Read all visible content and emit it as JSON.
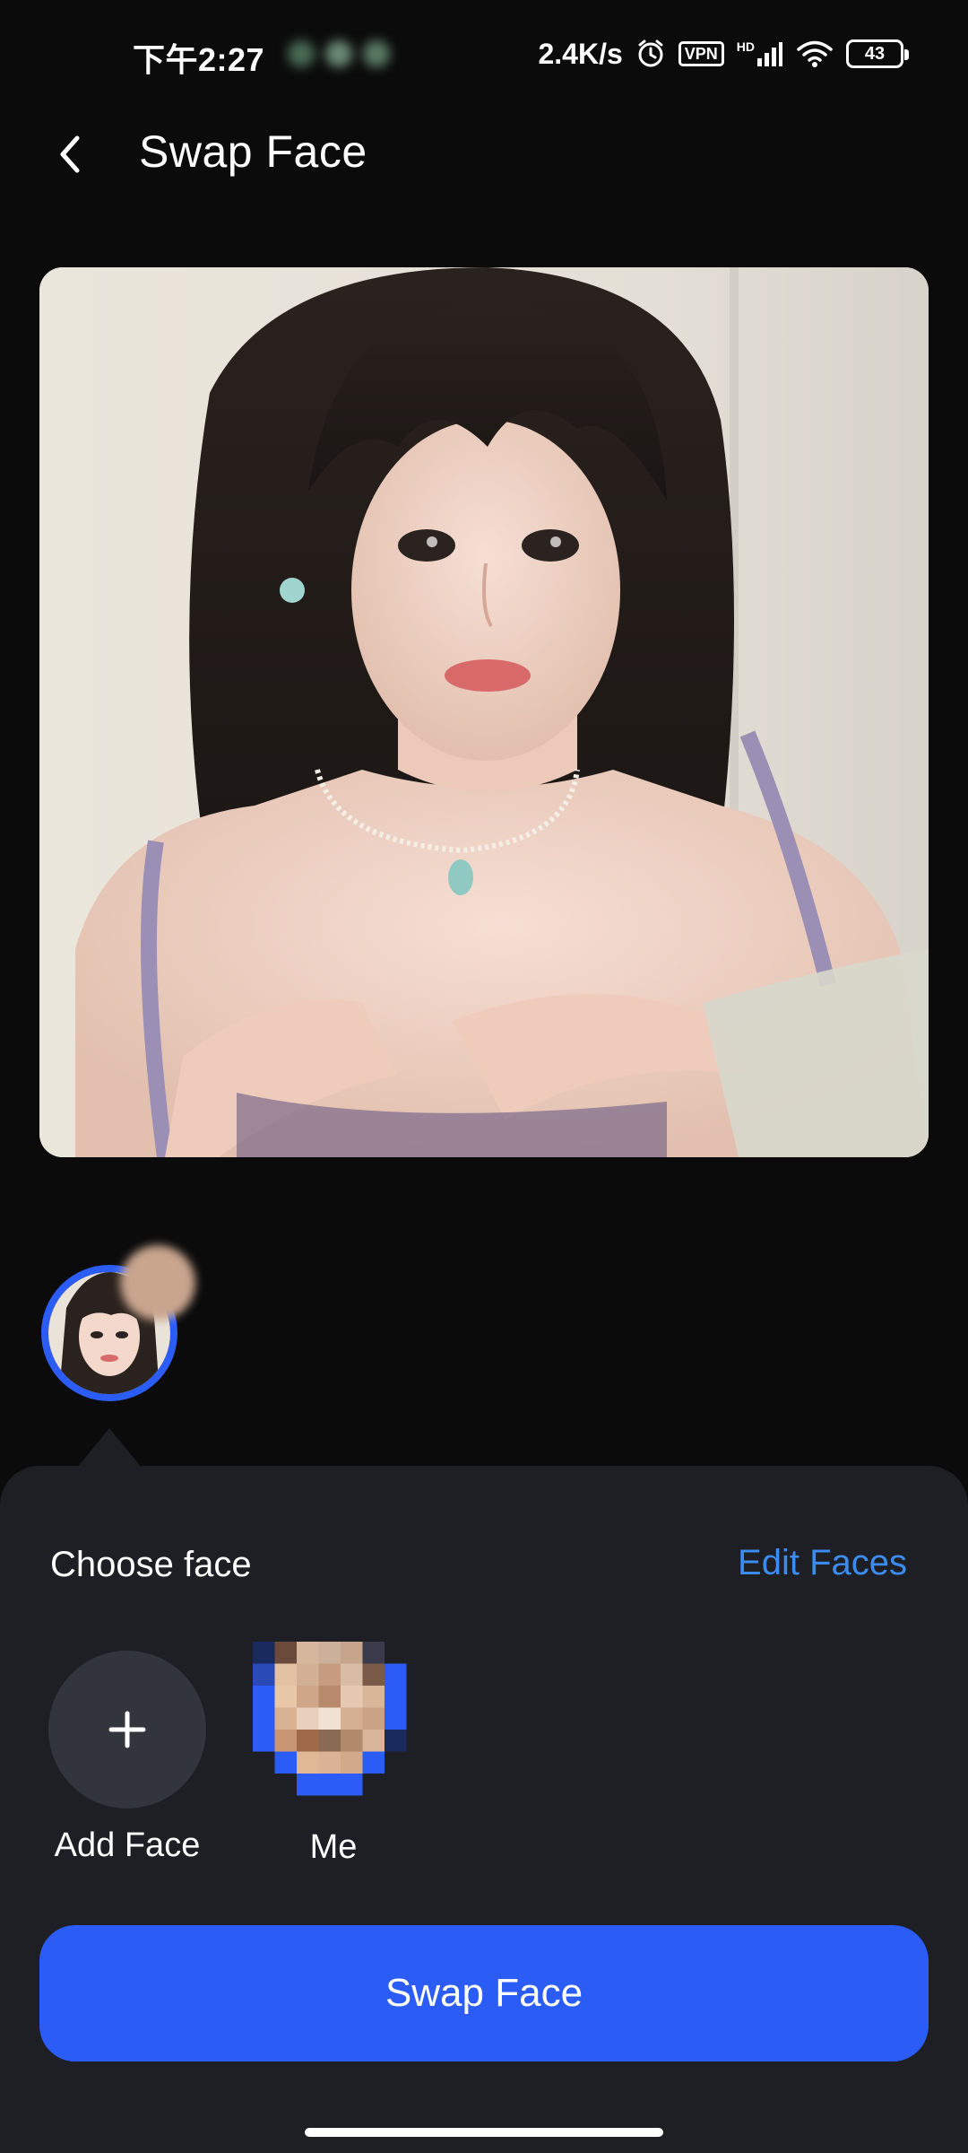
{
  "status_bar": {
    "time": "下午2:27",
    "speed": "2.4K/s",
    "vpn": "VPN",
    "network": "HD",
    "battery": "43"
  },
  "header": {
    "back_icon": "chevron-left-icon",
    "title": "Swap Face"
  },
  "photo": {
    "icon": "portrait-photo"
  },
  "sheet": {
    "choose_label": "Choose face",
    "edit_label": "Edit Faces",
    "faces": [
      {
        "label": "Add Face",
        "icon": "plus-icon"
      },
      {
        "label": "Me",
        "icon": "pixelated-avatar"
      }
    ]
  },
  "primary_button": {
    "label": "Swap Face"
  },
  "colors": {
    "background": "#0b0b0c",
    "sheet": "#1e1f25",
    "accent": "#2c5cf6",
    "link": "#3a8cf0"
  }
}
